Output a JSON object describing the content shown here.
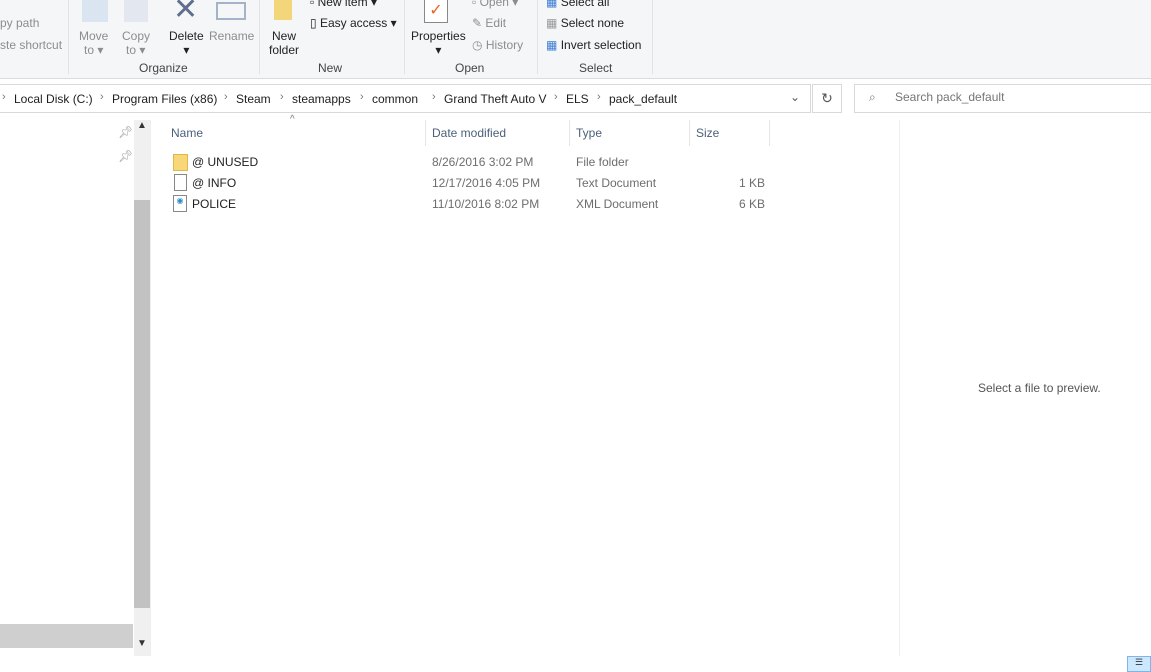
{
  "ribbon": {
    "clipboard": {
      "copy_path": "py path",
      "paste_shortcut": "ste shortcut"
    },
    "organize": {
      "move_to": [
        "Move",
        "to"
      ],
      "copy_to": [
        "Copy",
        "to"
      ],
      "delete": "Delete",
      "rename": "Rename",
      "label": "Organize"
    },
    "new": {
      "new_item": "New item",
      "easy_access": "Easy access",
      "new_folder": [
        "New",
        "folder"
      ],
      "label": "New"
    },
    "open": {
      "properties": "Properties",
      "open": "Open",
      "edit": "Edit",
      "history": "History",
      "label": "Open"
    },
    "select": {
      "select_all": "Select all",
      "select_none": "Select none",
      "invert": "Invert selection",
      "label": "Select"
    }
  },
  "address": {
    "crumbs": [
      "Local Disk (C:)",
      "Program Files (x86)",
      "Steam",
      "steamapps",
      "common",
      "Grand Theft Auto V",
      "ELS",
      "pack_default"
    ]
  },
  "search": {
    "placeholder": "Search pack_default"
  },
  "columns": {
    "name": "Name",
    "date": "Date modified",
    "type": "Type",
    "size": "Size"
  },
  "files": [
    {
      "name": "@ UNUSED",
      "date": "8/26/2016 3:02 PM",
      "type": "File folder",
      "size": "",
      "icon": "folder-icon"
    },
    {
      "name": "@ INFO",
      "date": "12/17/2016 4:05 PM",
      "type": "Text Document",
      "size": "1 KB",
      "icon": "text-file-icon"
    },
    {
      "name": "POLICE",
      "date": "11/10/2016 8:02 PM",
      "type": "XML Document",
      "size": "6 KB",
      "icon": "xml-file-icon"
    }
  ],
  "preview": {
    "message": "Select a file to preview."
  }
}
